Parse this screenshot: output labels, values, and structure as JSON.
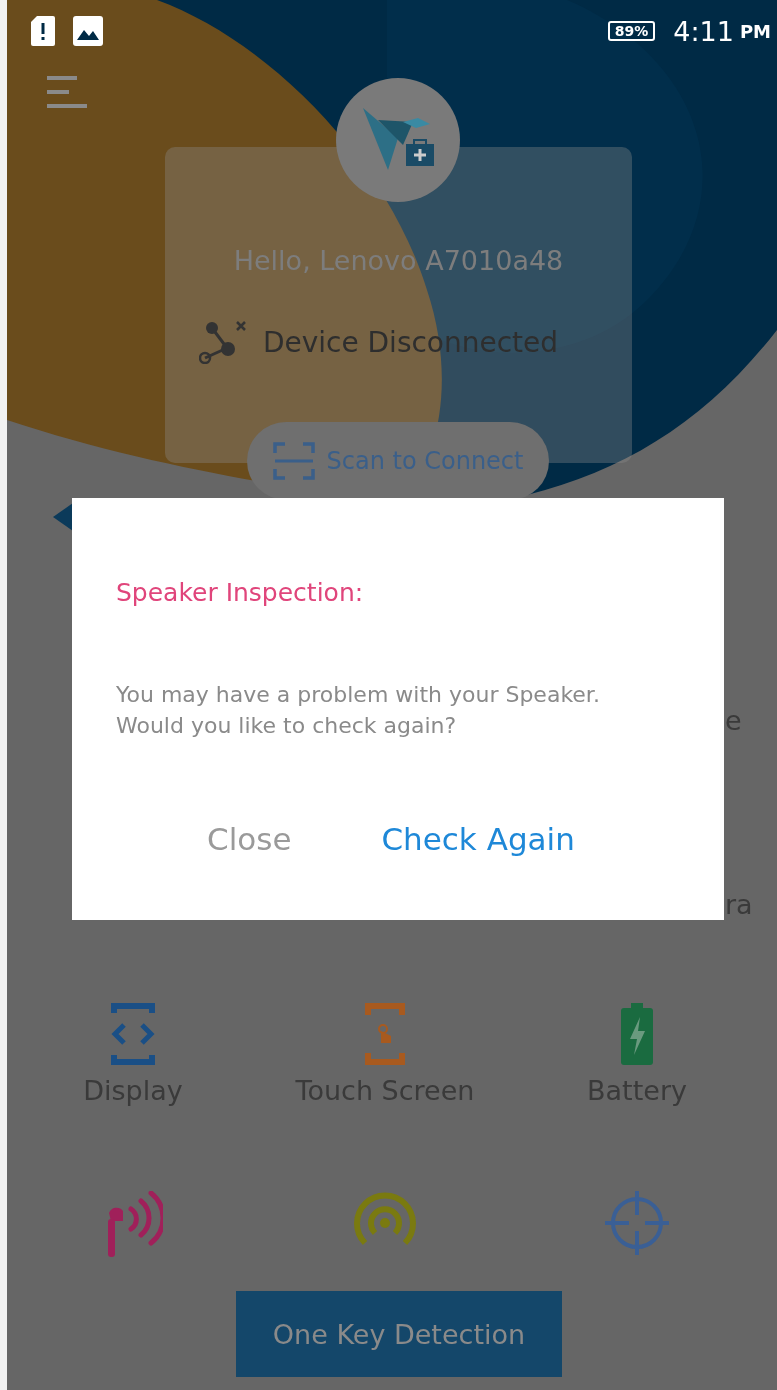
{
  "status_bar": {
    "battery": "89%",
    "time": "4:11",
    "period": "PM"
  },
  "header": {
    "greeting": "Hello, Lenovo A7010a48",
    "connection": "Device Disconnected",
    "scan_button": "Scan to Connect"
  },
  "covered_labels": [
    "e",
    "ra"
  ],
  "tests": [
    {
      "label": "Display",
      "kind": "display"
    },
    {
      "label": "Touch Screen",
      "kind": "touch"
    },
    {
      "label": "Battery",
      "kind": "battery"
    },
    {
      "kind": "earphone"
    },
    {
      "kind": "signal"
    },
    {
      "kind": "gps"
    }
  ],
  "action_button": "One Key Detection",
  "dialog": {
    "title": "Speaker Inspection:",
    "message": "You may have a problem with your Speaker.\nWould you like to check again?",
    "buttons": [
      {
        "label": "Close",
        "kind": "secondary"
      },
      {
        "label": "Check Again",
        "kind": "primary"
      }
    ]
  }
}
